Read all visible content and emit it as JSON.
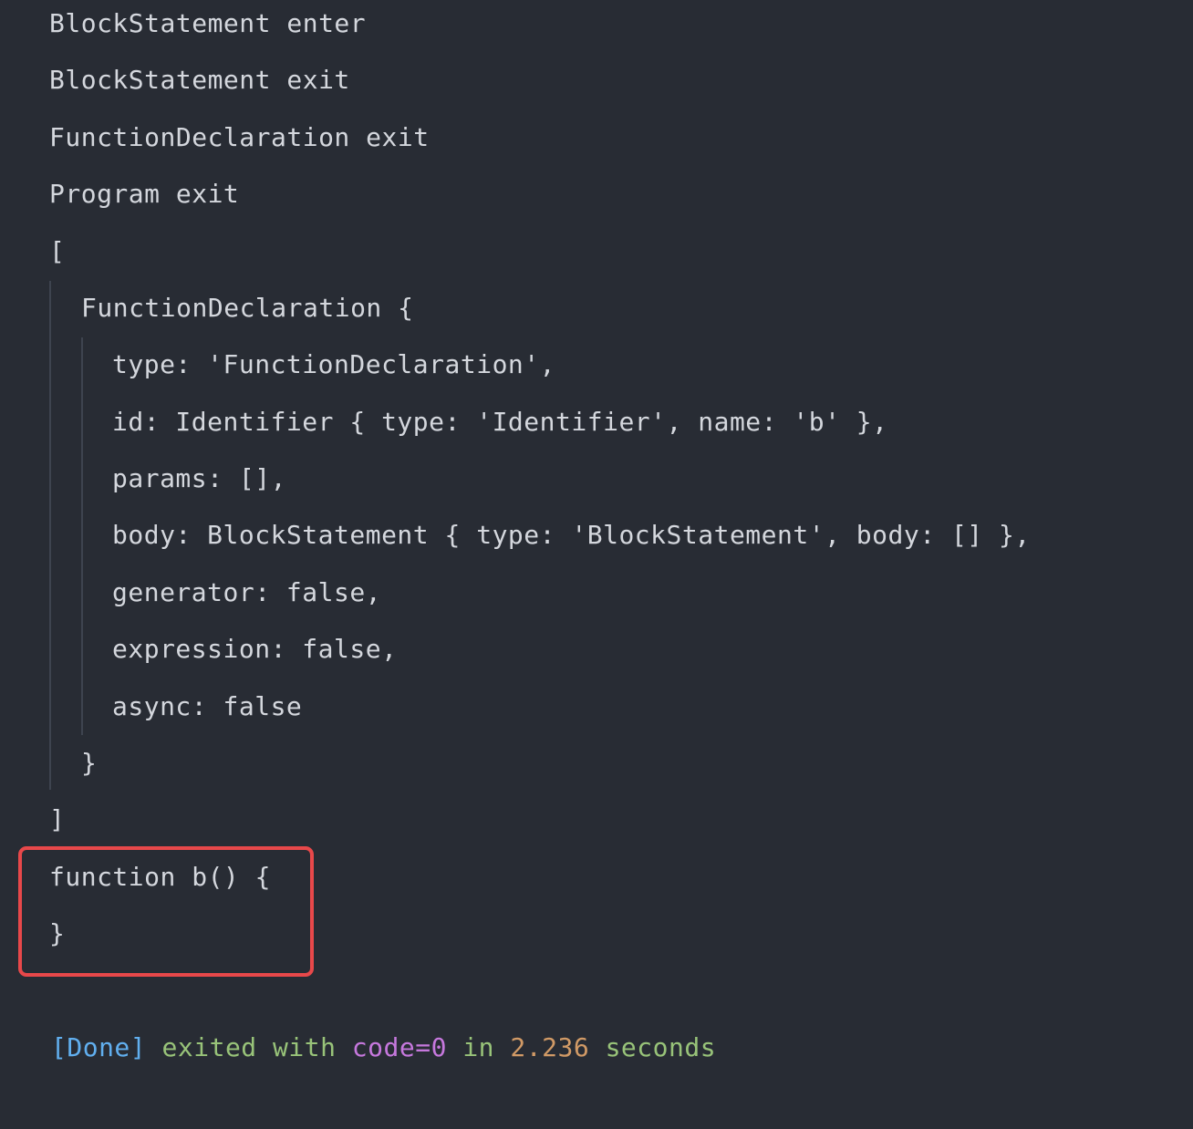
{
  "output": {
    "lines": [
      "BlockStatement enter",
      "BlockStatement exit",
      "FunctionDeclaration exit",
      "Program exit",
      "[",
      "FunctionDeclaration {",
      "type: 'FunctionDeclaration',",
      "id: Identifier { type: 'Identifier', name: 'b' },",
      "params: [],",
      "body: BlockStatement { type: 'BlockStatement', body: [] },",
      "generator: false,",
      "expression: false,",
      "async: false",
      "}",
      "]",
      "function b() {",
      "}"
    ]
  },
  "status": {
    "done": "[Done]",
    "exited_with": "exited with",
    "code": "code=0",
    "in": "in",
    "seconds_value": "2.236",
    "seconds": "seconds"
  },
  "colors": {
    "background": "#282c34",
    "text": "#d4d7dd",
    "highlight_border": "#e8484a",
    "done": "#61afef",
    "status_text": "#98c379",
    "code": "#c678dd",
    "number": "#d19a66"
  }
}
